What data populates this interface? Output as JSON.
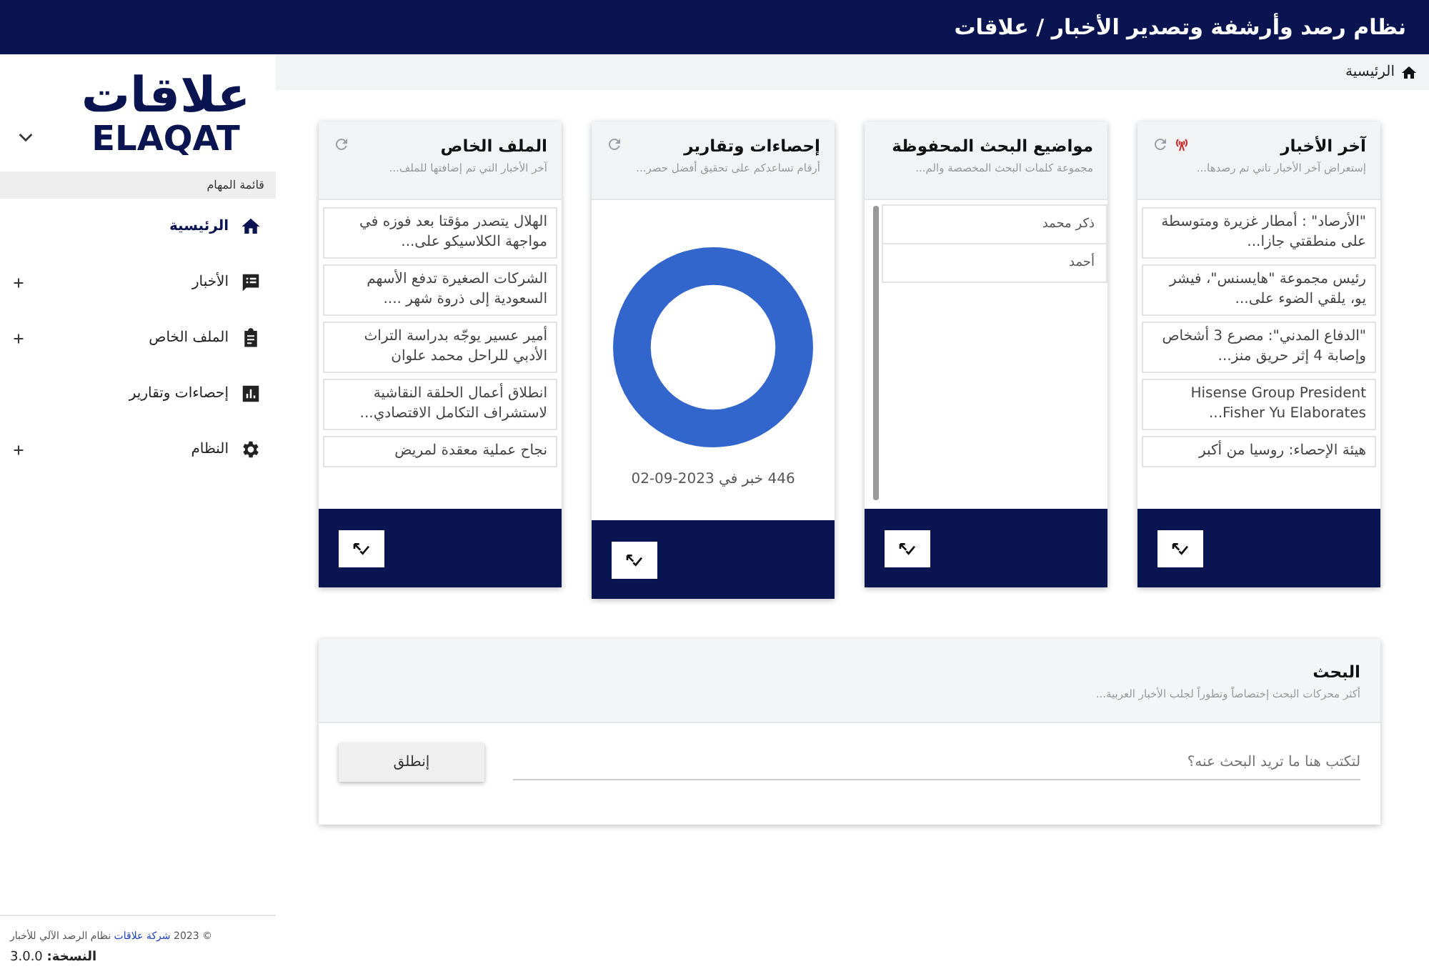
{
  "app_title": "نظام رصد وأرشفة وتصدير الأخبار / علاقات",
  "sidebar": {
    "logo_arabic": "علاقات",
    "logo_latin": "ELAQAT",
    "menu_heading": "قائمة المهام",
    "items": [
      {
        "label": "الرئيسية",
        "selected": true,
        "expandable": false
      },
      {
        "label": "الأخبار",
        "selected": false,
        "expandable": true
      },
      {
        "label": "الملف الخاص",
        "selected": false,
        "expandable": true
      },
      {
        "label": "إحصاءات وتقارير",
        "selected": false,
        "expandable": false
      },
      {
        "label": "النظام",
        "selected": false,
        "expandable": true
      }
    ],
    "copyright": "© 2023 ",
    "company_link": "شركة علاقات",
    "copyright_rest": " نظام الرصد الآلي للأخبار",
    "version_label": "النسخة:",
    "version": "3.0.0"
  },
  "breadcrumb": "الرئيسية",
  "cards": [
    {
      "kind": "list",
      "title": "آخر الأخبار",
      "subtitle": "إستعراض آخر الأخبار تاني تم رصدها...",
      "live": true,
      "refreshable": true,
      "items": [
        "\"الأرصاد\" : أمطار غزيرة ومتوسطة على منطقتي جازا...",
        "رئيس مجموعة \"هايسنس\"، فيشر يو، يلقي الضوء على...",
        "\"الدفاع المدني\": مصرع 3 أشخاص وإصابة 4 إثر حريق منز...",
        "Hisense Group President Fisher Yu Elaborates...",
        "هيئة الإحصاء: روسيا من أكبر"
      ]
    },
    {
      "kind": "saved",
      "title": "مواضيع البحث المحفوظة",
      "subtitle": "مجموعة كلمات البحث المخصصة والم...",
      "live": false,
      "refreshable": false,
      "items": [
        "ذكر محمد",
        "أحمد"
      ]
    },
    {
      "kind": "chart",
      "title": "إحصاءات وتقارير",
      "subtitle": "أرقام تساعدكم على تحقيق أفضل حصر...",
      "live": false,
      "refreshable": true,
      "caption": "446 خبر في 2023-09-02"
    },
    {
      "kind": "list",
      "title": "الملف الخاص",
      "subtitle": "آخر الأخبار التي تم إضافتها للملف...",
      "live": false,
      "refreshable": true,
      "items": [
        "الهلال يتصدر مؤقتا بعد فوزه في مواجهة الكلاسيكو على...",
        "الشركات الصغيرة تدفع الأسهم السعودية إلى ذروة شهر ....",
        "أمير عسير يوجّه بدراسة التراث الأدبي للراحل محمد علوان",
        "انطلاق أعمال الحلقة النقاشية لاستشراف التكامل الاقتصادي...",
        "نجاح عملية معقدة لمريض"
      ]
    }
  ],
  "search": {
    "title": "البحث",
    "subtitle": "أكثر محركات البحث إختصاصاً وتطوراً لجلب الأخبار العربية...",
    "placeholder": "لتكتب هنا ما تريد البحث عنه؟",
    "button": "إنطلق"
  }
}
